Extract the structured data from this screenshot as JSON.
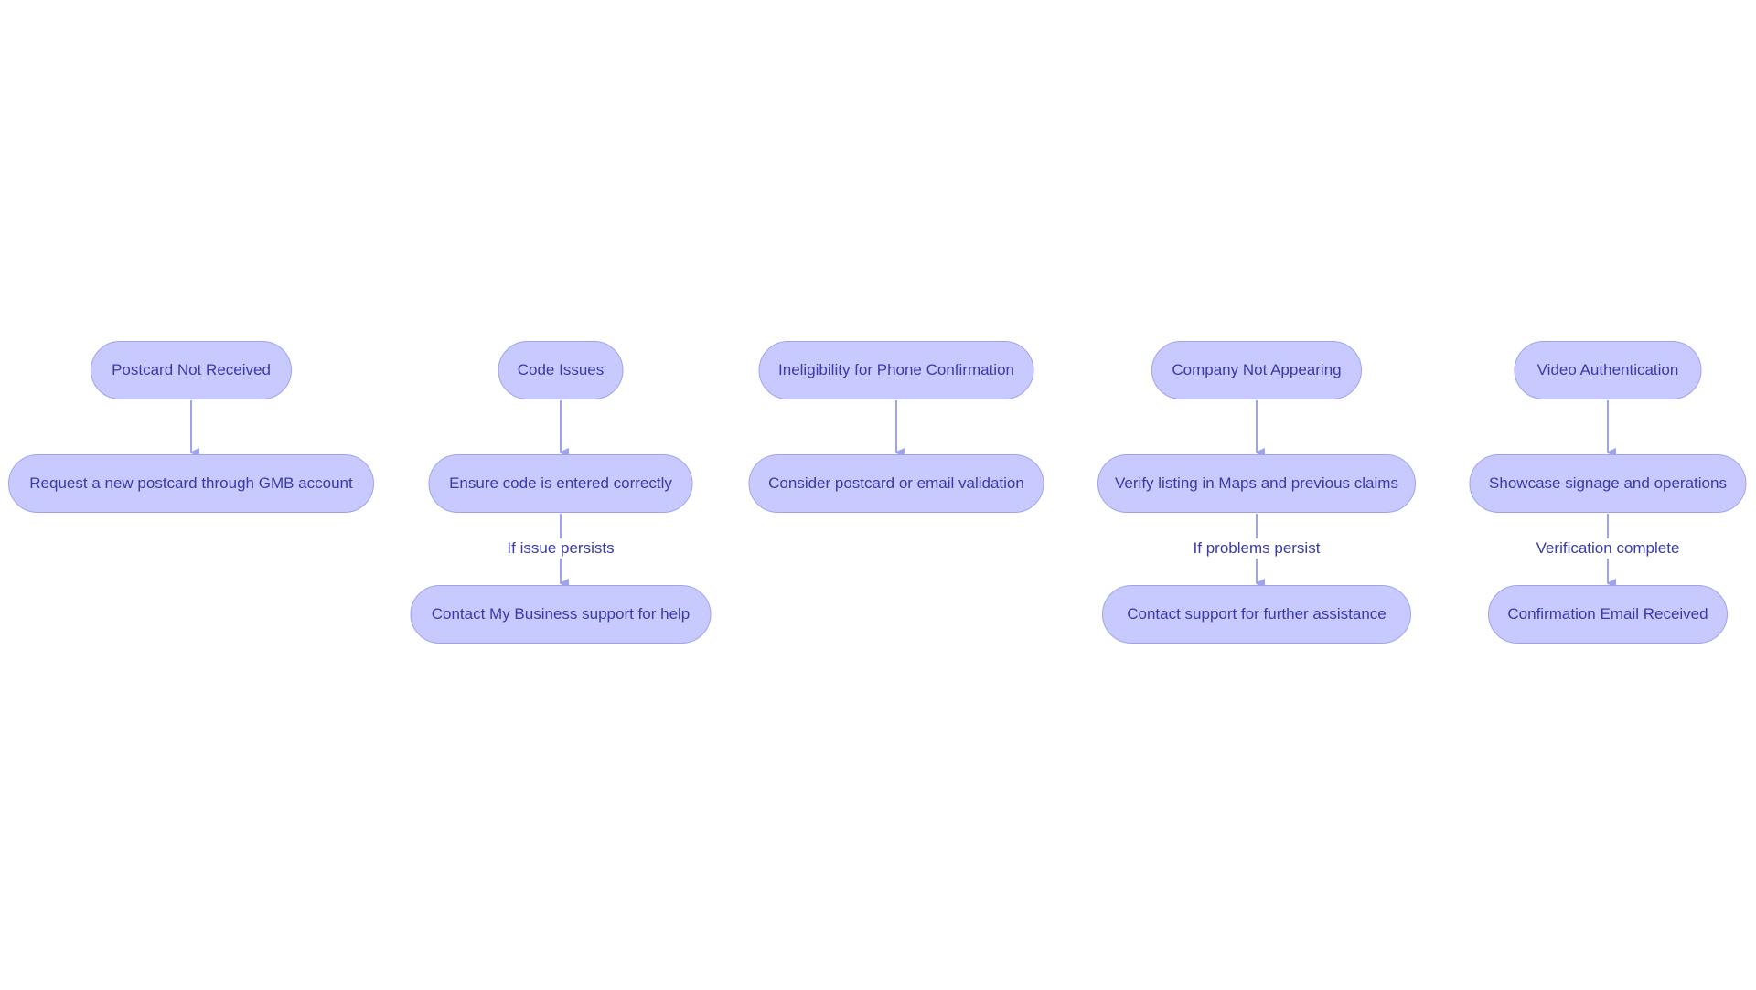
{
  "colors": {
    "node_fill": "#c8caff",
    "node_stroke": "#9fa3ee",
    "text": "#3a3aa8",
    "edge": "#9fa3ee"
  },
  "columns": [
    {
      "root": "Postcard Not Received",
      "step": "Request a new postcard through GMB account"
    },
    {
      "root": "Code Issues",
      "step": "Ensure code is entered correctly",
      "edge_label": "If issue persists",
      "final": "Contact My Business support for help"
    },
    {
      "root": "Ineligibility for Phone Confirmation",
      "step": "Consider postcard or email validation"
    },
    {
      "root": "Company Not Appearing",
      "step": "Verify listing in Maps and previous claims",
      "edge_label": "If problems persist",
      "final": "Contact support for further assistance"
    },
    {
      "root": "Video Authentication",
      "step": "Showcase signage and operations",
      "edge_label": "Verification complete",
      "final": "Confirmation Email Received"
    }
  ]
}
